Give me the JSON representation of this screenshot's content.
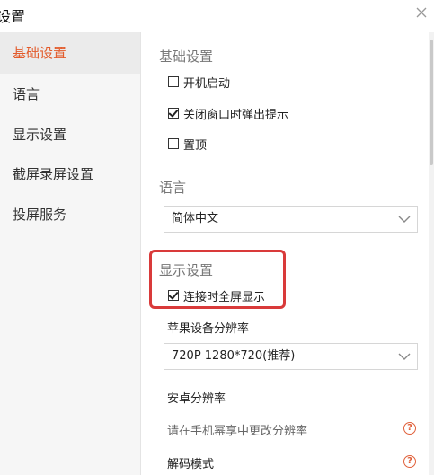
{
  "window": {
    "title": "设置"
  },
  "sidebar": {
    "items": [
      {
        "label": "基础设置",
        "active": true
      },
      {
        "label": "语言",
        "active": false
      },
      {
        "label": "显示设置",
        "active": false
      },
      {
        "label": "截屏录屏设置",
        "active": false
      },
      {
        "label": "投屏服务",
        "active": false
      }
    ]
  },
  "main": {
    "basic": {
      "title": "基础设置",
      "options": [
        {
          "label": "开机启动",
          "checked": false
        },
        {
          "label": "关闭窗口时弹出提示",
          "checked": true
        },
        {
          "label": "置顶",
          "checked": false
        }
      ]
    },
    "language": {
      "title": "语言",
      "selected": "简体中文"
    },
    "display": {
      "title": "显示设置",
      "fullscreen_label": "连接时全屏显示",
      "fullscreen_checked": true,
      "apple_resolution_label": "苹果设备分辨率",
      "apple_resolution_selected": "720P 1280*720(推荐)",
      "android_resolution_label": "安卓分辨率",
      "android_resolution_hint": "请在手机幂享中更改分辨率",
      "decode_mode_label": "解码模式"
    }
  },
  "colors": {
    "accent": "#e35b2b",
    "highlight_border": "#d93a3a",
    "sidebar_bg": "#f6f6f6",
    "help_icon": "#e0603a"
  },
  "icons": {
    "close": "close-icon",
    "dropdown": "chevron-down-icon",
    "help": "question-circle-icon"
  }
}
